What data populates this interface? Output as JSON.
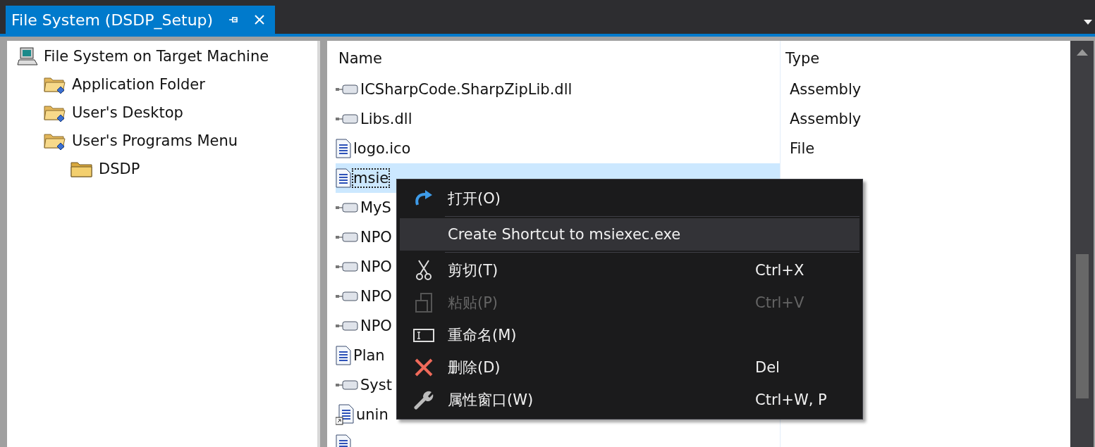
{
  "tab": {
    "title": "File System (DSDP_Setup)",
    "selected": true
  },
  "tree": [
    {
      "label": "File System on Target Machine",
      "kind": "computer",
      "children": [
        {
          "label": "Application Folder",
          "kind": "special-folder"
        },
        {
          "label": "User's Desktop",
          "kind": "special-folder"
        },
        {
          "label": "User's Programs Menu",
          "kind": "special-folder",
          "children": [
            {
              "label": "DSDP",
              "kind": "folder"
            }
          ]
        }
      ]
    }
  ],
  "table": {
    "columns": [
      "Name",
      "Type"
    ],
    "rows": [
      {
        "kind": "assembly",
        "name": "ICSharpCode.SharpZipLib.dll",
        "type": "Assembly",
        "selected": false
      },
      {
        "kind": "assembly",
        "name": "Libs.dll",
        "type": "Assembly",
        "selected": false
      },
      {
        "kind": "file",
        "name": "logo.ico",
        "type": "File",
        "selected": false
      },
      {
        "kind": "file",
        "name": "msie",
        "selected": true
      },
      {
        "kind": "assembly",
        "name": "MyS",
        "selected": false
      },
      {
        "kind": "assembly",
        "name": "NPO",
        "selected": false
      },
      {
        "kind": "assembly",
        "name": "NPO",
        "selected": false
      },
      {
        "kind": "assembly",
        "name": "NPO",
        "selected": false
      },
      {
        "kind": "assembly",
        "name": "NPO",
        "selected": false
      },
      {
        "kind": "file",
        "name": "Plan",
        "selected": false
      },
      {
        "kind": "assembly",
        "name": "Syst",
        "selected": false
      },
      {
        "kind": "shortcut",
        "name": "unin",
        "selected": false
      },
      {
        "kind": "file",
        "selected": false
      }
    ]
  },
  "context_menu": [
    {
      "kind": "open",
      "label": "打开(O)",
      "disabled": false,
      "selected": false
    },
    {
      "kind": "separator"
    },
    {
      "kind": "none",
      "label": "Create Shortcut to msiexec.exe",
      "disabled": false,
      "selected": true
    },
    {
      "kind": "separator"
    },
    {
      "kind": "cut",
      "label": "剪切(T)",
      "shortcut": "Ctrl+X",
      "disabled": false,
      "selected": false
    },
    {
      "kind": "paste",
      "label": "粘贴(P)",
      "shortcut": "Ctrl+V",
      "disabled": true,
      "selected": false
    },
    {
      "kind": "rename",
      "label": "重命名(M)",
      "disabled": false,
      "selected": false
    },
    {
      "kind": "delete",
      "label": "删除(D)",
      "shortcut": "Del",
      "disabled": false,
      "selected": false
    },
    {
      "kind": "properties",
      "label": "属性窗口(W)",
      "shortcut": "Ctrl+W, P",
      "disabled": false,
      "selected": false
    }
  ]
}
